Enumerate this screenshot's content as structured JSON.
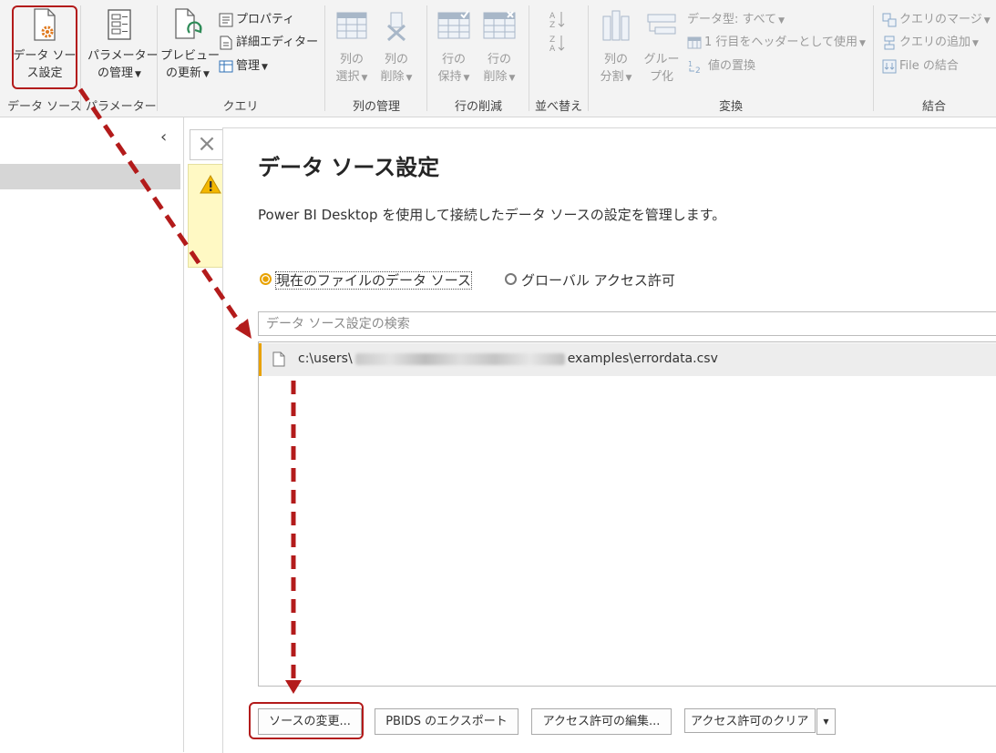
{
  "ribbon": {
    "data_source": {
      "button_line1": "データ ソー",
      "button_line2": "ス設定",
      "group_label": "データ ソース"
    },
    "parameters": {
      "button_line1": "パラメーター",
      "button_line2": "の管理",
      "group_label": "パラメーター"
    },
    "query": {
      "refresh_line1": "プレビュー",
      "refresh_line2": "の更新",
      "properties": "プロパティ",
      "advanced_editor": "詳細エディター",
      "manage": "管理",
      "group_label": "クエリ"
    },
    "manage_columns": {
      "select_line1": "列の",
      "select_line2": "選択",
      "remove_line1": "列の",
      "remove_line2": "削除",
      "group_label": "列の管理"
    },
    "reduce_rows": {
      "keep_line1": "行の",
      "keep_line2": "保持",
      "remove_line1": "行の",
      "remove_line2": "削除",
      "group_label": "行の削減"
    },
    "sort": {
      "group_label": "並べ替え"
    },
    "transform": {
      "split_line1": "列の",
      "split_line2": "分割",
      "group_line1": "グルー",
      "group_line2": "プ化",
      "data_type": "データ型: すべて",
      "use_header": "1 行目をヘッダーとして使用",
      "replace_values": "値の置換",
      "group_label": "変換"
    },
    "combine": {
      "merge_queries": "クエリのマージ",
      "append_queries": "クエリの追加",
      "combine_files": "File の結合",
      "group_label": "結合"
    }
  },
  "dialog": {
    "title": "データ ソース設定",
    "description": "Power BI Desktop を使用して接続したデータ ソースの設定を管理します。",
    "radio_current": "現在のファイルのデータ ソース",
    "radio_global": "グローバル アクセス許可",
    "search_placeholder": "データ ソース設定の検索",
    "list_item_prefix": "c:\\users\\",
    "list_item_suffix": "examples\\errordata.csv",
    "buttons": {
      "change_source": "ソースの変更...",
      "export_pbids": "PBIDS のエクスポート",
      "edit_permissions": "アクセス許可の編集...",
      "clear_permissions": "アクセス許可のクリア"
    }
  },
  "colors": {
    "highlight": "#b31b1b",
    "accent_orange": "#e8a100",
    "ribbon_bg": "#f3f3f3",
    "warning_bg": "#fff9c4"
  },
  "icons": [
    "data-source-settings-icon",
    "parameters-icon",
    "refresh-preview-icon",
    "properties-icon",
    "advanced-editor-icon",
    "manage-icon",
    "choose-columns-icon",
    "remove-columns-icon",
    "keep-rows-icon",
    "remove-rows-icon",
    "sort-asc-icon",
    "sort-desc-icon",
    "split-column-icon",
    "group-by-icon",
    "table-icon",
    "replace-values-icon",
    "merge-queries-icon",
    "append-queries-icon",
    "combine-files-icon",
    "close-icon",
    "warning-icon",
    "file-icon",
    "chevron-left-icon"
  ]
}
